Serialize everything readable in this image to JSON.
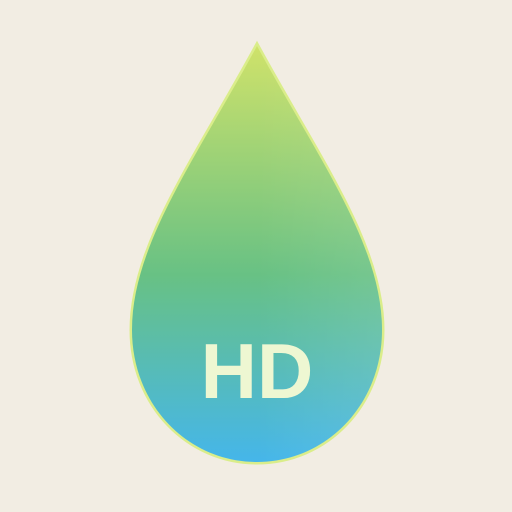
{
  "app_icon": {
    "badge_text": "HD",
    "icon_name": "water-drop-icon",
    "colors": {
      "background": "#f2ede3",
      "drop_top": "#cfe26a",
      "drop_mid": "#6ec483",
      "drop_bottom": "#48b6e8",
      "outline": "#d6ec7a",
      "badge_text_color": "#eef7d2"
    }
  }
}
